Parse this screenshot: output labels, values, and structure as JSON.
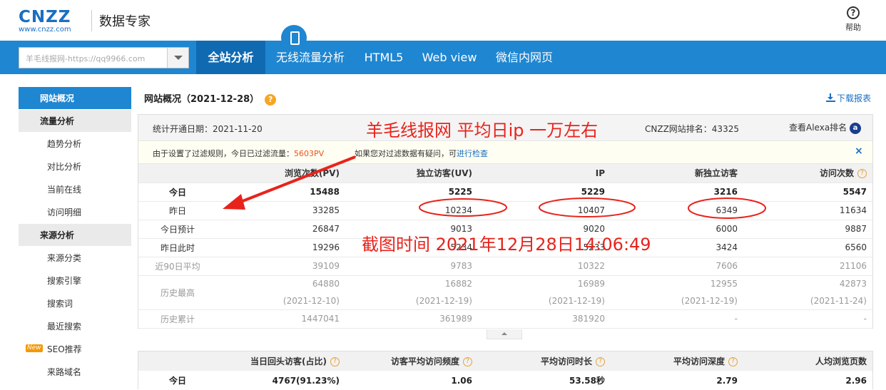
{
  "header": {
    "logo_text": "CNZZ",
    "logo_url": "www.cnzz.com",
    "product_name": "数据专家",
    "help_label": "帮助"
  },
  "nav": {
    "site_select": "羊毛线报网-https://qq9966.com",
    "tabs": [
      {
        "label": "全站分析",
        "active": true
      },
      {
        "label": "无线流量分析",
        "active": false
      },
      {
        "label": "HTML5",
        "active": false
      },
      {
        "label": "Web view",
        "active": false
      },
      {
        "label": "微信内网页",
        "active": false
      }
    ]
  },
  "sidebar": {
    "sections": [
      {
        "label": "网站概况",
        "active": true,
        "items": []
      },
      {
        "label": "流量分析",
        "active": false,
        "items": [
          "趋势分析",
          "对比分析",
          "当前在线",
          "访问明细"
        ]
      },
      {
        "label": "来源分析",
        "active": false,
        "items": [
          "来源分类",
          "搜索引擎",
          "搜索词",
          "最近搜索",
          "SEO推荐",
          "来路域名"
        ]
      }
    ],
    "new_badge": "New"
  },
  "main": {
    "title": "网站概况（2021-12-28）",
    "download_label": "下载报表",
    "open_date": "统计开通日期：2021-11-20",
    "rank": "CNZZ网站排名：43325",
    "alexa_label": "查看Alexa排名",
    "filter_notice_pre": "由于设置了过滤规则，今日已过滤流量：",
    "filter_pv": "5603PV",
    "filter_question": "如果您对过滤数据有疑问，可",
    "filter_link": "进行检查",
    "close_label": "×"
  },
  "stats_table": {
    "headers": [
      "",
      "浏览次数(PV)",
      "独立访客(UV)",
      "IP",
      "新独立访客",
      "访问次数"
    ],
    "rows": [
      {
        "label": "今日",
        "values": [
          "15488",
          "5225",
          "5229",
          "3216",
          "5547"
        ]
      },
      {
        "label": "昨日",
        "values": [
          "33285",
          "10234",
          "10407",
          "6349",
          "11634"
        ]
      },
      {
        "label": "今日预计",
        "values": [
          "26847",
          "9013",
          "9020",
          "6000",
          "9887"
        ]
      },
      {
        "label": "昨日此时",
        "values": [
          "19296",
          "5234",
          "5233",
          "3424",
          "6560"
        ]
      },
      {
        "label": "近90日平均",
        "values": [
          "39109",
          "9783",
          "10322",
          "7606",
          "21106"
        ]
      },
      {
        "label": "历史最高",
        "values": [
          "64880",
          "16882",
          "16989",
          "12955",
          "42873"
        ],
        "dates": [
          "(2021-12-10)",
          "(2021-12-19)",
          "(2021-12-19)",
          "(2021-12-19)",
          "(2021-11-24)"
        ]
      },
      {
        "label": "历史累计",
        "values": [
          "1447041",
          "361989",
          "381920",
          "-",
          "-"
        ]
      }
    ]
  },
  "stats_table2": {
    "headers": [
      "",
      "当日回头访客(占比)",
      "访客平均访问频度",
      "平均访问时长",
      "平均访问深度",
      "人均浏览页数"
    ],
    "row": {
      "label": "今日",
      "values": [
        "4767(91.23%)",
        "1.06",
        "53.58秒",
        "2.79",
        "2.96"
      ]
    }
  },
  "annotations": {
    "title": "羊毛线报网 平均日ip 一万左右",
    "time": "截图时间  2021年12月28日14:06:49",
    "color": "#e8231b"
  },
  "colors": {
    "brand_blue": "#1f86d1",
    "active_tab": "#0f6ab2",
    "accent_orange": "#f5a623",
    "link": "#1a6fc2"
  }
}
